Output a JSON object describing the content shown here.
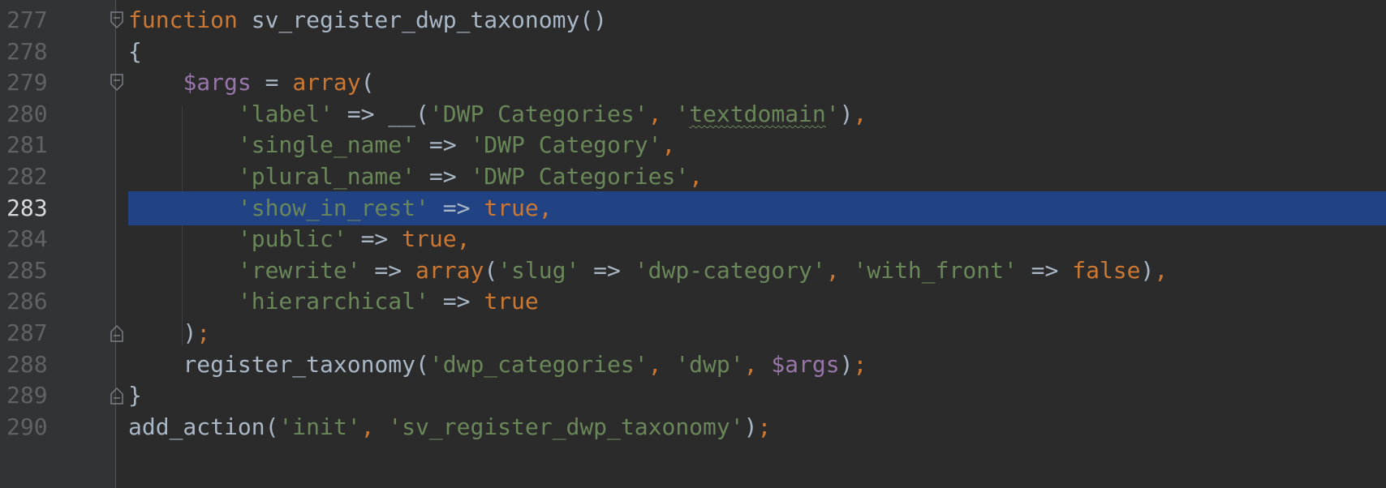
{
  "editor": {
    "language": "php",
    "current_line": "283",
    "colors": {
      "background": "#2b2b2b",
      "gutter": "#313335",
      "selection": "#214283",
      "keyword": "#cc7832",
      "string": "#6a8759",
      "variable": "#9876aa",
      "plain": "#a9b7c6",
      "line_number": "#606366"
    },
    "lines": [
      {
        "number": "277",
        "fold": "fold-open-icon",
        "tokens": [
          {
            "t": "function",
            "c": "kw"
          },
          {
            "t": " sv_register_dwp_taxonomy",
            "c": "fnname"
          },
          {
            "t": "()",
            "c": "op"
          }
        ]
      },
      {
        "number": "278",
        "tokens": [
          {
            "t": "{",
            "c": "op"
          }
        ]
      },
      {
        "number": "279",
        "fold": "fold-open-icon",
        "tokens": [
          {
            "t": "    ",
            "c": "op"
          },
          {
            "t": "$args",
            "c": "var"
          },
          {
            "t": " = ",
            "c": "op"
          },
          {
            "t": "array",
            "c": "kw"
          },
          {
            "t": "(",
            "c": "op"
          }
        ]
      },
      {
        "number": "280",
        "tokens": [
          {
            "t": "        ",
            "c": "op"
          },
          {
            "t": "'label'",
            "c": "str"
          },
          {
            "t": " => __(",
            "c": "op"
          },
          {
            "t": "'DWP Categories'",
            "c": "str"
          },
          {
            "t": ", ",
            "c": "kw"
          },
          {
            "t": "'",
            "c": "str"
          },
          {
            "t": "textdomain",
            "c": "str typo"
          },
          {
            "t": "'",
            "c": "str"
          },
          {
            "t": ")",
            "c": "op"
          },
          {
            "t": ",",
            "c": "kw"
          }
        ]
      },
      {
        "number": "281",
        "tokens": [
          {
            "t": "        ",
            "c": "op"
          },
          {
            "t": "'single_name'",
            "c": "str"
          },
          {
            "t": " => ",
            "c": "op"
          },
          {
            "t": "'DWP Category'",
            "c": "str"
          },
          {
            "t": ",",
            "c": "kw"
          }
        ]
      },
      {
        "number": "282",
        "tokens": [
          {
            "t": "        ",
            "c": "op"
          },
          {
            "t": "'plural_name'",
            "c": "str"
          },
          {
            "t": " => ",
            "c": "op"
          },
          {
            "t": "'DWP Categories'",
            "c": "str"
          },
          {
            "t": ",",
            "c": "kw"
          }
        ]
      },
      {
        "number": "283",
        "current": true,
        "tokens": [
          {
            "t": "        ",
            "c": "op"
          },
          {
            "t": "'show_in_rest'",
            "c": "str"
          },
          {
            "t": " => ",
            "c": "op"
          },
          {
            "t": "true",
            "c": "kw"
          },
          {
            "t": ",",
            "c": "kw"
          }
        ]
      },
      {
        "number": "284",
        "tokens": [
          {
            "t": "        ",
            "c": "op"
          },
          {
            "t": "'public'",
            "c": "str"
          },
          {
            "t": " => ",
            "c": "op"
          },
          {
            "t": "true",
            "c": "kw"
          },
          {
            "t": ",",
            "c": "kw"
          }
        ]
      },
      {
        "number": "285",
        "tokens": [
          {
            "t": "        ",
            "c": "op"
          },
          {
            "t": "'rewrite'",
            "c": "str"
          },
          {
            "t": " => ",
            "c": "op"
          },
          {
            "t": "array",
            "c": "kw"
          },
          {
            "t": "(",
            "c": "op"
          },
          {
            "t": "'slug'",
            "c": "str"
          },
          {
            "t": " => ",
            "c": "op"
          },
          {
            "t": "'dwp-category'",
            "c": "str"
          },
          {
            "t": ", ",
            "c": "kw"
          },
          {
            "t": "'with_front'",
            "c": "str"
          },
          {
            "t": " => ",
            "c": "op"
          },
          {
            "t": "false",
            "c": "kw"
          },
          {
            "t": ")",
            "c": "op"
          },
          {
            "t": ",",
            "c": "kw"
          }
        ]
      },
      {
        "number": "286",
        "tokens": [
          {
            "t": "        ",
            "c": "op"
          },
          {
            "t": "'hierarchical'",
            "c": "str"
          },
          {
            "t": " => ",
            "c": "op"
          },
          {
            "t": "true",
            "c": "kw"
          }
        ]
      },
      {
        "number": "287",
        "fold": "fold-close-icon",
        "tokens": [
          {
            "t": "    ",
            "c": "op"
          },
          {
            "t": ")",
            "c": "op"
          },
          {
            "t": ";",
            "c": "kw"
          }
        ]
      },
      {
        "number": "288",
        "tokens": [
          {
            "t": "    ",
            "c": "op"
          },
          {
            "t": "register_taxonomy",
            "c": "fn"
          },
          {
            "t": "(",
            "c": "op"
          },
          {
            "t": "'dwp_categories'",
            "c": "str"
          },
          {
            "t": ", ",
            "c": "kw"
          },
          {
            "t": "'dwp'",
            "c": "str"
          },
          {
            "t": ", ",
            "c": "kw"
          },
          {
            "t": "$args",
            "c": "var"
          },
          {
            "t": ")",
            "c": "op"
          },
          {
            "t": ";",
            "c": "kw"
          }
        ]
      },
      {
        "number": "289",
        "fold": "fold-close-icon",
        "tokens": [
          {
            "t": "}",
            "c": "op"
          }
        ]
      },
      {
        "number": "290",
        "tokens": [
          {
            "t": "add_action",
            "c": "fn"
          },
          {
            "t": "(",
            "c": "op"
          },
          {
            "t": "'init'",
            "c": "str"
          },
          {
            "t": ", ",
            "c": "kw"
          },
          {
            "t": "'sv_register_dwp_taxonomy'",
            "c": "str"
          },
          {
            "t": ")",
            "c": "op"
          },
          {
            "t": ";",
            "c": "kw"
          }
        ]
      }
    ]
  }
}
